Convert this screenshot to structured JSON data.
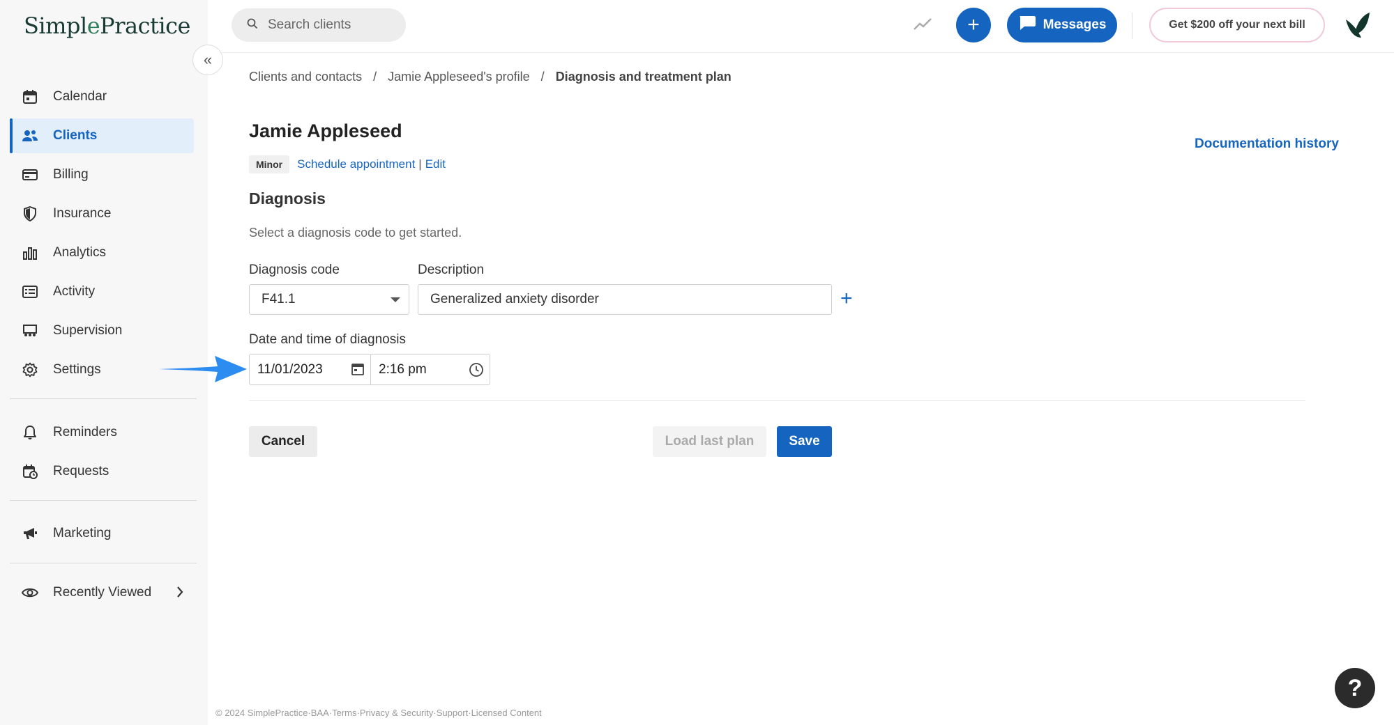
{
  "app": {
    "logo": {
      "text_before": "Simpl",
      "text_leaf": "e",
      "text_after": "Practice"
    }
  },
  "sidebar": {
    "items": [
      {
        "label": "Calendar",
        "icon": "calendar-icon"
      },
      {
        "label": "Clients",
        "icon": "clients-icon",
        "active": true
      },
      {
        "label": "Billing",
        "icon": "billing-icon"
      },
      {
        "label": "Insurance",
        "icon": "shield-icon"
      },
      {
        "label": "Analytics",
        "icon": "bar-chart-icon"
      },
      {
        "label": "Activity",
        "icon": "activity-list-icon"
      },
      {
        "label": "Supervision",
        "icon": "supervision-icon"
      },
      {
        "label": "Settings",
        "icon": "gear-icon"
      }
    ],
    "secondary": [
      {
        "label": "Reminders",
        "icon": "bell-icon"
      },
      {
        "label": "Requests",
        "icon": "calendar-request-icon"
      }
    ],
    "marketing": {
      "label": "Marketing",
      "icon": "megaphone-icon"
    },
    "recently_viewed": {
      "label": "Recently Viewed",
      "icon": "eye-icon"
    },
    "collapse_glyph": "«"
  },
  "topbar": {
    "search_placeholder": "Search clients",
    "plus_glyph": "+",
    "messages_label": "Messages",
    "promo_label": "Get $200 off your next bill"
  },
  "breadcrumb": {
    "items": [
      "Clients and contacts",
      "Jamie Appleseed's profile",
      "Diagnosis and treatment plan"
    ],
    "separator": "/"
  },
  "client": {
    "name": "Jamie Appleseed",
    "badge": "Minor",
    "schedule_link": "Schedule appointment",
    "pipe": "|",
    "edit_link": "Edit"
  },
  "documentation_history": "Documentation history",
  "diagnosis": {
    "title": "Diagnosis",
    "hint": "Select a diagnosis code to get started.",
    "code_label": "Diagnosis code",
    "code_value": "F41.1",
    "description_label": "Description",
    "description_value": "Generalized anxiety disorder",
    "add_glyph": "+",
    "datetime_label": "Date and time of diagnosis",
    "date_value": "11/01/2023",
    "time_value": "2:16 pm"
  },
  "actions": {
    "cancel": "Cancel",
    "load_last_plan": "Load last plan",
    "save": "Save"
  },
  "footer": {
    "items": [
      "© 2024 SimplePractice",
      "BAA",
      "Terms",
      "Privacy & Security",
      "Support",
      "Licensed Content"
    ],
    "separator": " · "
  },
  "help_glyph": "?",
  "colors": {
    "accent": "#1565c0",
    "sidebar_bg": "#f7f7f7",
    "active_bg": "#e3eefb",
    "arrow": "#2d8cf0"
  }
}
